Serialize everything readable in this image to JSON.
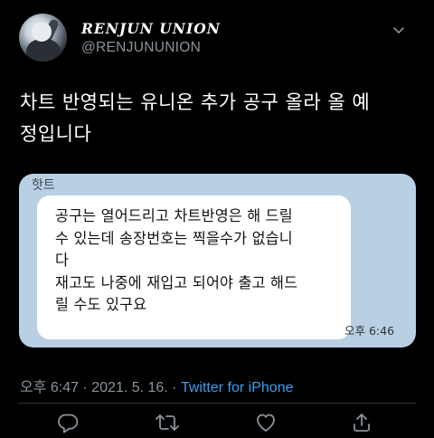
{
  "author": {
    "name": "RENJUN UNION",
    "handle": "@RENJUNUNION"
  },
  "tweet": {
    "text_line1": "차트 반영되는 유니온 추가 공구 올라 올 예",
    "text_line2": "정입니다"
  },
  "screenshot": {
    "sender": "핫트",
    "message_lines": [
      "공구는 열어드리고 차트반영은 해 드릴",
      "수 있는데 송장번호는 찍을수가 없습니",
      "다",
      "재고도 나중에 재입고 되어야 출고 해드",
      "릴 수도 있구요"
    ],
    "time": "오후 6:46"
  },
  "meta": {
    "time": "오후 6:47",
    "separator1": " · ",
    "date": "2021. 5. 16.",
    "separator2": " · ",
    "source": "Twitter for iPhone"
  },
  "colors": {
    "background": "#000000",
    "secondary_text": "#8b949c",
    "link": "#3b9ff0",
    "chat_background": "#b9cfe3"
  },
  "icons": [
    "more-icon",
    "reply-icon",
    "retweet-icon",
    "like-icon",
    "share-icon"
  ]
}
